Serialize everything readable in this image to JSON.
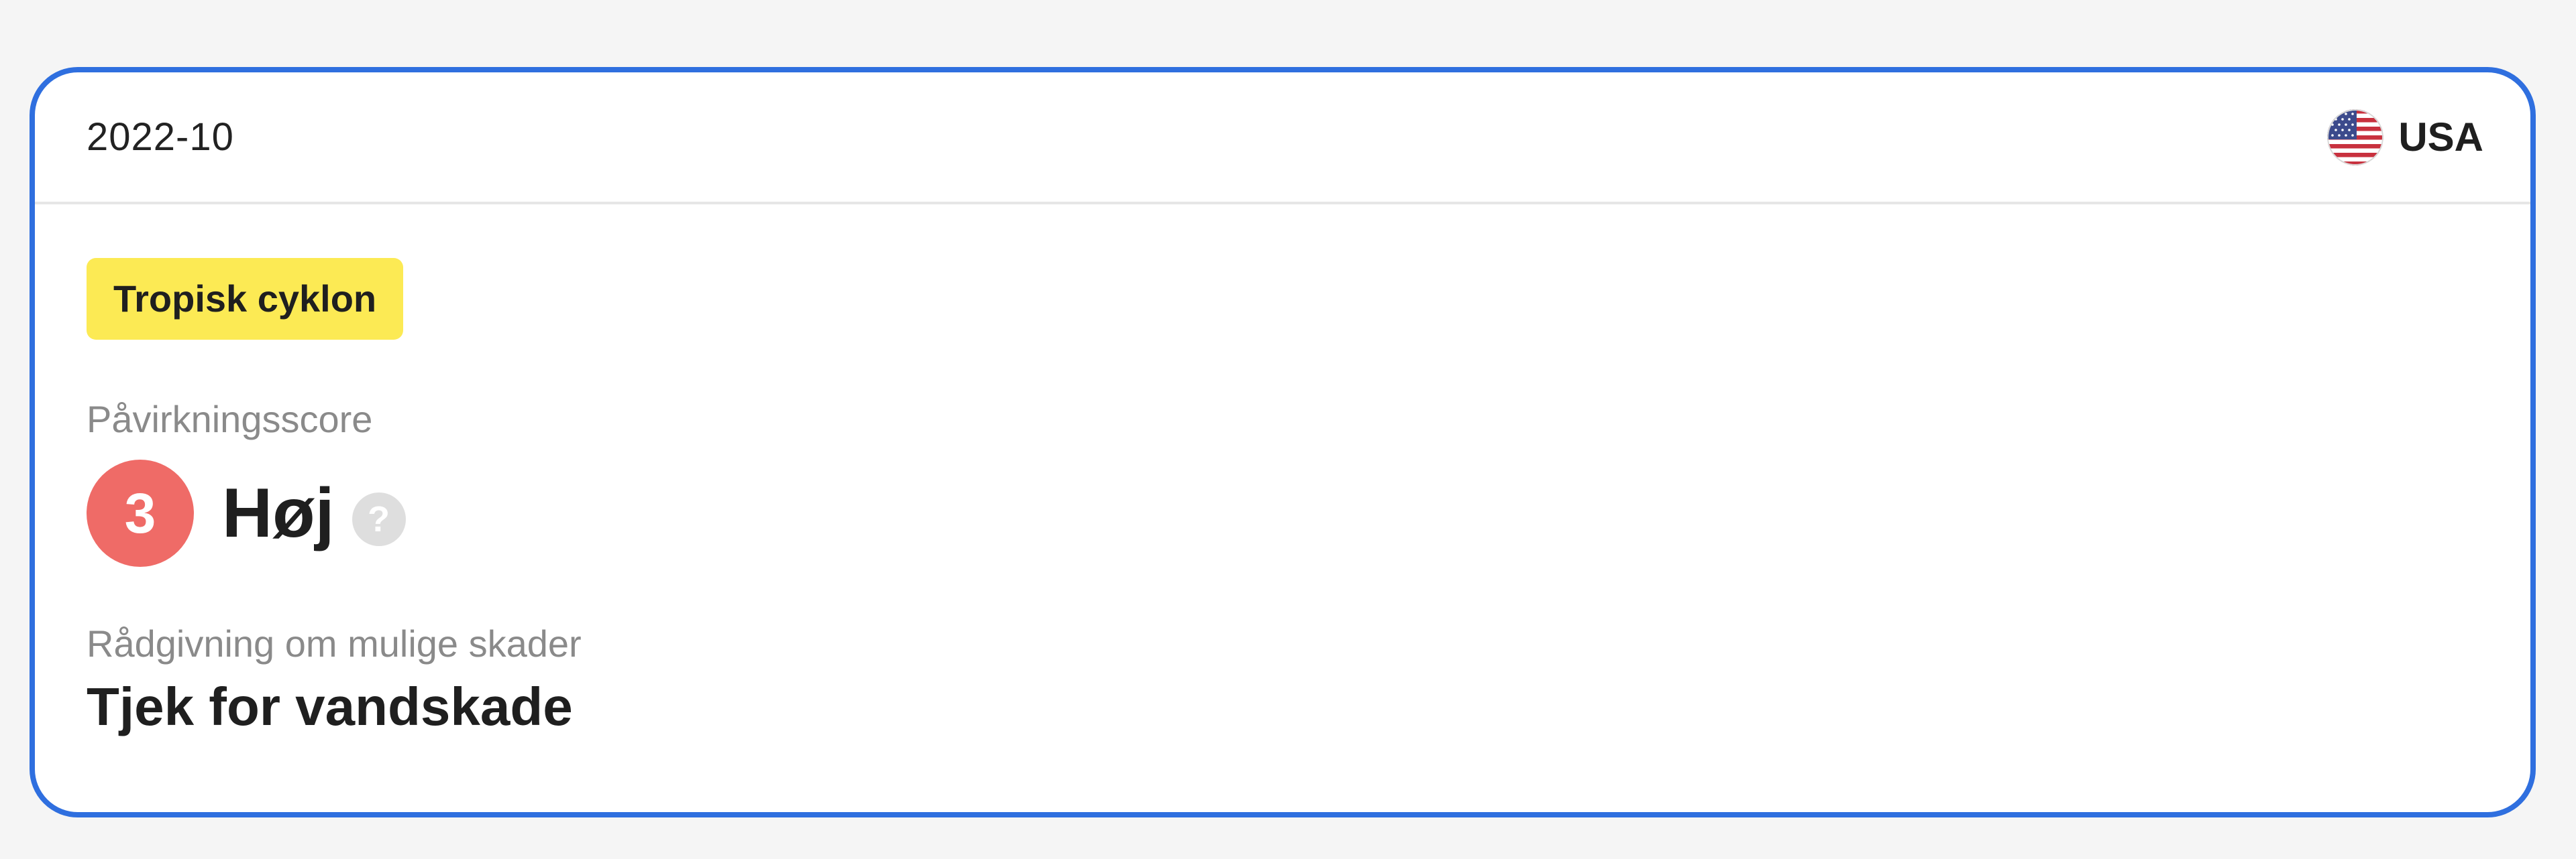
{
  "card": {
    "date": "2022-10",
    "country": {
      "label": "USA",
      "flag_icon": "us-flag-icon"
    },
    "event_tag": "Tropisk cyklon",
    "impact": {
      "label": "Påvirkningsscore",
      "score": "3",
      "level": "Høj",
      "help_symbol": "?"
    },
    "advice": {
      "label": "Rådgivning om mulige skader",
      "text": "Tjek for vandskade"
    }
  },
  "colors": {
    "card_border": "#2f6fdf",
    "tag_background": "#fcea54",
    "score_badge": "#ef6b67",
    "help_icon": "#dedede"
  }
}
